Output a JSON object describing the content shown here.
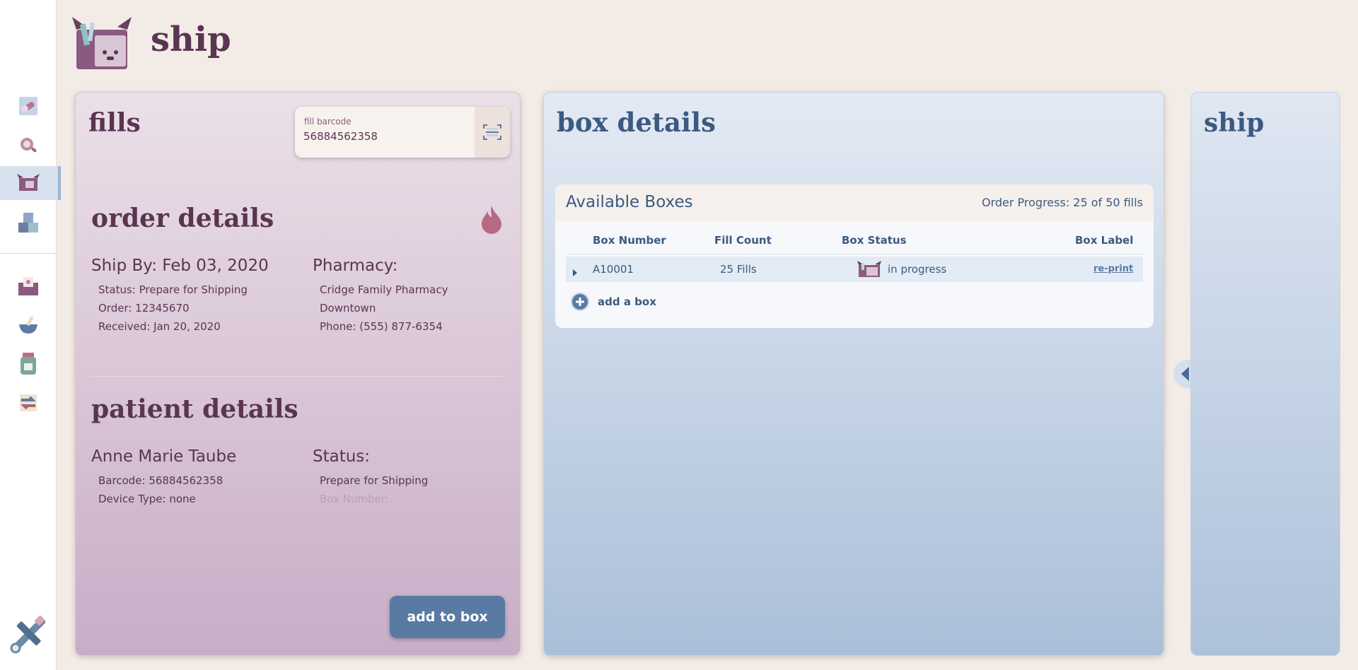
{
  "header": {
    "title": "ship",
    "logo_icon": "ship-box-logo"
  },
  "sidebar": {
    "items": [
      {
        "name": "fill-icon"
      },
      {
        "name": "search-icon"
      },
      {
        "name": "ship-icon",
        "active": true
      },
      {
        "name": "boxes-icon"
      },
      {
        "name": "inbox-icon"
      },
      {
        "name": "mortar-pestle-icon"
      },
      {
        "name": "pill-bottle-icon"
      },
      {
        "name": "transfer-icon"
      }
    ],
    "tools_icon": "wrench-screwdriver-icon"
  },
  "fills": {
    "title": "fills",
    "barcode_label": "fill barcode",
    "barcode_value": "56884562358",
    "order": {
      "title": "order details",
      "ship_by": "Ship By: Feb 03, 2020",
      "status": "Status: Prepare for Shipping",
      "order_number": "Order: 12345670",
      "received": "Received: Jan 20, 2020",
      "pharmacy_label": "Pharmacy:",
      "pharmacy_name_1": "Cridge Family Pharmacy",
      "pharmacy_name_2": "Downtown",
      "phone": "Phone: (555) 877-6354"
    },
    "patient": {
      "title": "patient details",
      "name": "Anne Marie Taube",
      "barcode": "Barcode: 56884562358",
      "device_type": "Device Type: none",
      "status_label": "Status:",
      "status_value": "Prepare for Shipping",
      "box_number": "Box Number:"
    },
    "add_button": "add to box"
  },
  "box_details": {
    "title": "box details",
    "card_title": "Available Boxes",
    "order_progress": "Order Progress: 25 of 50 fills",
    "columns": [
      "Box Number",
      "Fill Count",
      "Box Status",
      "Box Label"
    ],
    "rows": [
      {
        "box_number": "A10001",
        "fill_count": "25 Fills",
        "status": "in progress",
        "label_action": "re-print"
      }
    ],
    "add_box": "add a box"
  },
  "ship": {
    "title": "ship"
  },
  "colors": {
    "plum": "#5a3552",
    "navy": "#3c5a80",
    "button_blue": "#587aa3",
    "background": "#f3ebe5"
  }
}
